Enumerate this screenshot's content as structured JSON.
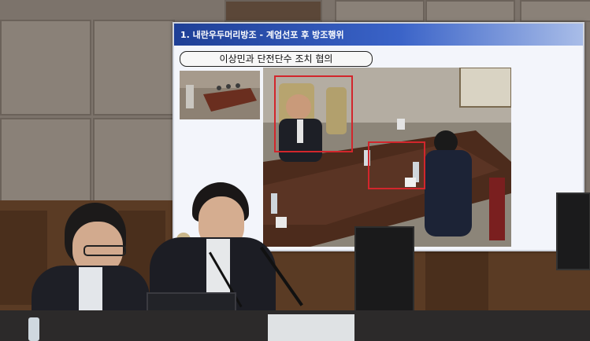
{
  "slide": {
    "header_title": "1. 내란우두머리방조 - 계엄선포 후 방조행위",
    "subtitle": "이상민과 단전단수 조치 협의"
  },
  "colors": {
    "header_blue": "#1e3f96",
    "highlight_red": "#d2262c",
    "wall_gray": "#7c736b",
    "wood": "#5a3b24"
  }
}
